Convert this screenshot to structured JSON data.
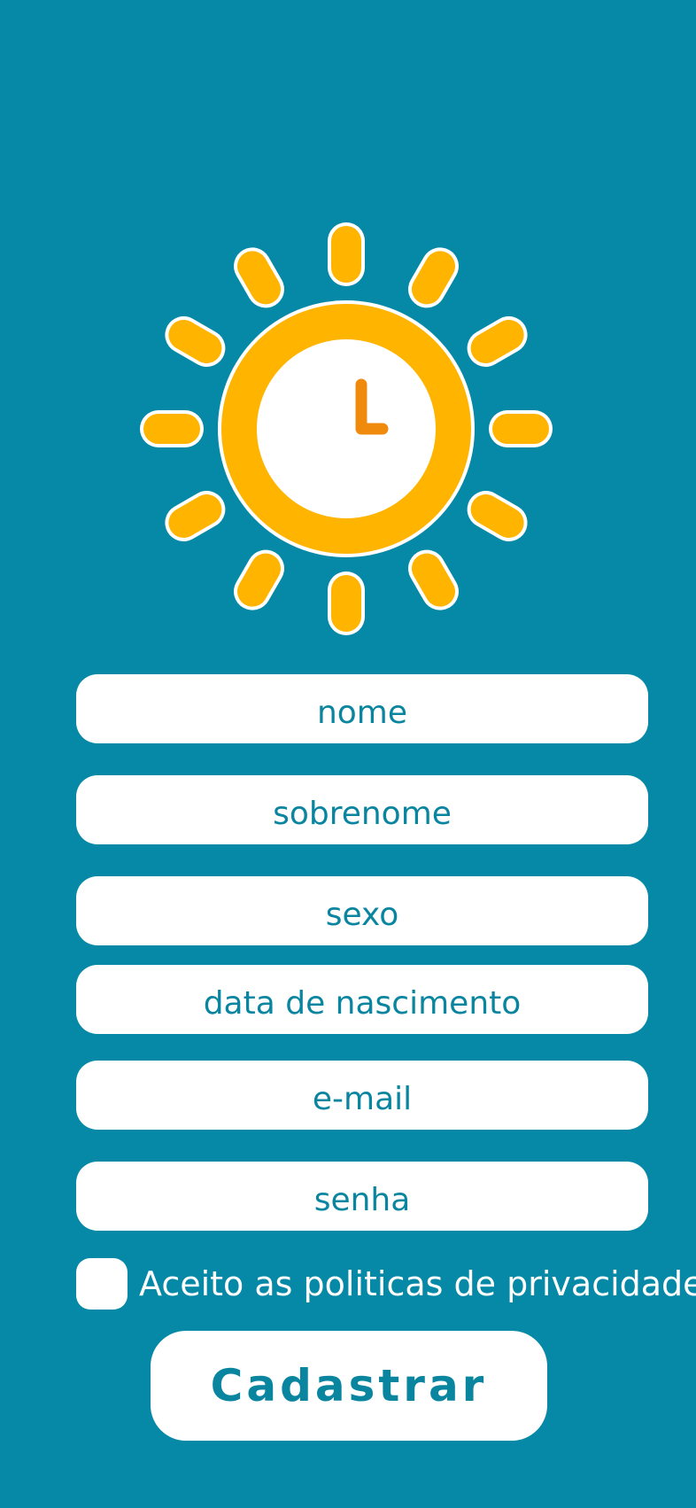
{
  "logo": {
    "name": "sun-clock-logo",
    "colors": {
      "sun": "#ffb400",
      "outline": "#ffffff",
      "face": "#ffffff",
      "hands": "#f08a0c"
    }
  },
  "form": {
    "fields": [
      {
        "name": "nome-input",
        "placeholder": "nome"
      },
      {
        "name": "sobrenome-input",
        "placeholder": "sobrenome"
      },
      {
        "name": "sexo-input",
        "placeholder": "sexo"
      },
      {
        "name": "data-nascimento-input",
        "placeholder": "data de nascimento"
      },
      {
        "name": "email-input",
        "placeholder": "e-mail"
      },
      {
        "name": "senha-input",
        "placeholder": "senha"
      }
    ],
    "privacy_label": "Aceito as politicas de privacidade",
    "privacy_checked": false,
    "submit_label": "Cadastrar"
  },
  "colors": {
    "background": "#0589a6",
    "accent_text": "#0a85a0",
    "field_bg": "#ffffff"
  }
}
